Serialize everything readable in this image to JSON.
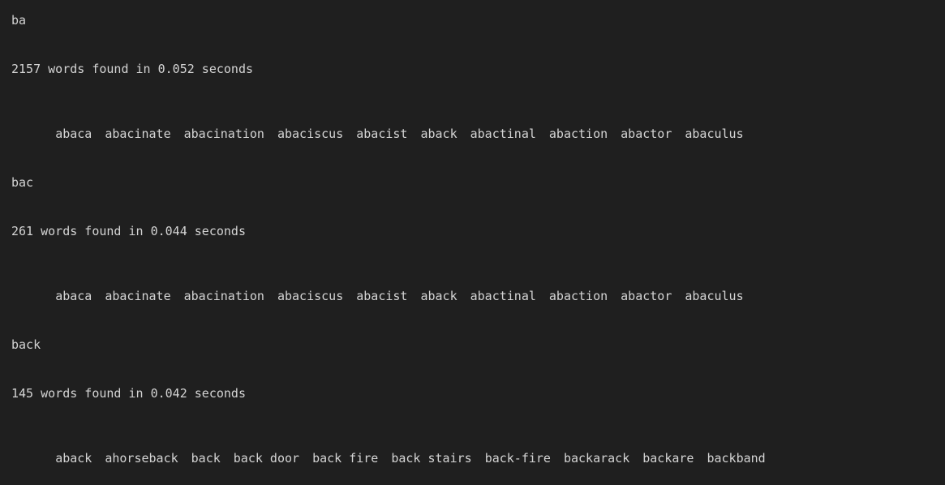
{
  "output": {
    "blocks": [
      {
        "query": "ba",
        "summary": "2157 words found in 0.052 seconds",
        "words": [
          "abaca",
          "abacinate",
          "abacination",
          "abaciscus",
          "abacist",
          "aback",
          "abactinal",
          "abaction",
          "abactor",
          "abaculus"
        ]
      },
      {
        "query": "bac",
        "summary": "261 words found in 0.044 seconds",
        "words": [
          "abaca",
          "abacinate",
          "abacination",
          "abaciscus",
          "abacist",
          "aback",
          "abactinal",
          "abaction",
          "abactor",
          "abaculus"
        ]
      },
      {
        "query": "back",
        "summary": "145 words found in 0.042 seconds",
        "words": [
          "aback",
          "ahorseback",
          "back",
          "back door",
          "back fire",
          "back stairs",
          "back-fire",
          "backarack",
          "backare",
          "backband"
        ]
      }
    ]
  }
}
